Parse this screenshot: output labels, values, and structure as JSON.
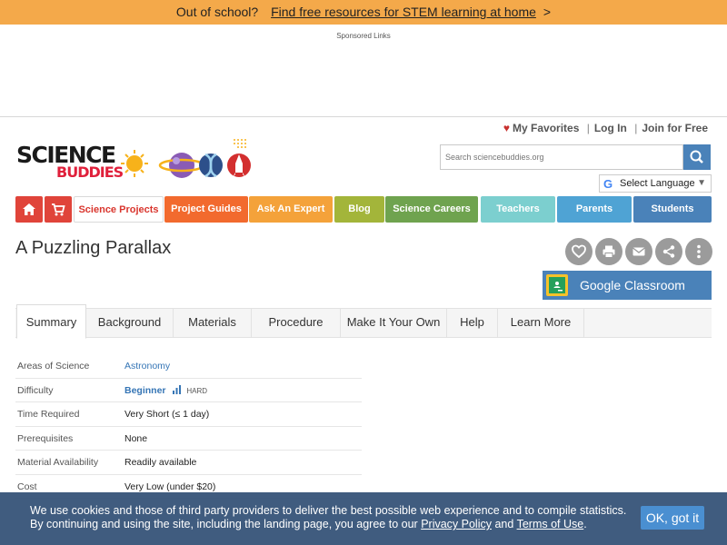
{
  "promo": {
    "lead": "Out of school?",
    "link": "Find free resources for STEM learning at home",
    "arrow": ">"
  },
  "ads": {
    "sponsored_label": "Sponsored Links"
  },
  "account": {
    "favorites": "My Favorites",
    "login": "Log In",
    "join": "Join for Free",
    "separator": "|"
  },
  "logo": {
    "line1": "SCIENCE",
    "line2": "BUDDIES"
  },
  "search": {
    "placeholder": "Search sciencebuddies.org"
  },
  "language": {
    "label": "Select Language"
  },
  "nav": [
    {
      "label": "",
      "icon": "home-icon",
      "color": "#e0443a"
    },
    {
      "label": "",
      "icon": "cart-icon",
      "color": "#e0443a"
    },
    {
      "label": "Science Projects",
      "color": "#ffffff"
    },
    {
      "label": "Project Guides",
      "color": "#f26a2e"
    },
    {
      "label": "Ask An Expert",
      "color": "#f4a23a"
    },
    {
      "label": "Blog",
      "color": "#a3b53a"
    },
    {
      "label": "Science Careers",
      "color": "#6fa34f"
    },
    {
      "label": "Teachers",
      "color": "#7ccfcf"
    },
    {
      "label": "Parents",
      "color": "#4fa3d4"
    },
    {
      "label": "Students",
      "color": "#4a82b9"
    }
  ],
  "page": {
    "title": "A Puzzling Parallax"
  },
  "actions": {
    "icons": [
      "heart-icon",
      "print-icon",
      "email-icon",
      "share-icon",
      "more-icon"
    ],
    "classroom_label": "Google Classroom"
  },
  "tabs": [
    "Summary",
    "Background",
    "Materials",
    "Procedure",
    "Make It Your Own",
    "Help",
    "Learn More"
  ],
  "facts": [
    {
      "key": "Areas of Science",
      "value": "Astronomy"
    },
    {
      "key": "Difficulty",
      "value": "Beginner",
      "extra": "HARD"
    },
    {
      "key": "Time Required",
      "value": "Very Short (≤ 1 day)"
    },
    {
      "key": "Prerequisites",
      "value": "None"
    },
    {
      "key": "Material Availability",
      "value": "Readily available"
    },
    {
      "key": "Cost",
      "value": "Very Low (under $20)"
    }
  ],
  "cookie": {
    "line1": "We use cookies and those of third party providers to deliver the best possible web experience and to compile statistics.",
    "line2_pre": "By continuing and using the site, including the landing page, you agree to our",
    "privacy": "Privacy Policy",
    "and": "and",
    "terms": "Terms of Use",
    "end": ".",
    "ok": "OK, got it"
  },
  "colors": {
    "promo_bg": "#f4a94a",
    "brand_red": "#e0203b",
    "accent_blue": "#4a82b9",
    "cookie_bg": "#345277"
  }
}
